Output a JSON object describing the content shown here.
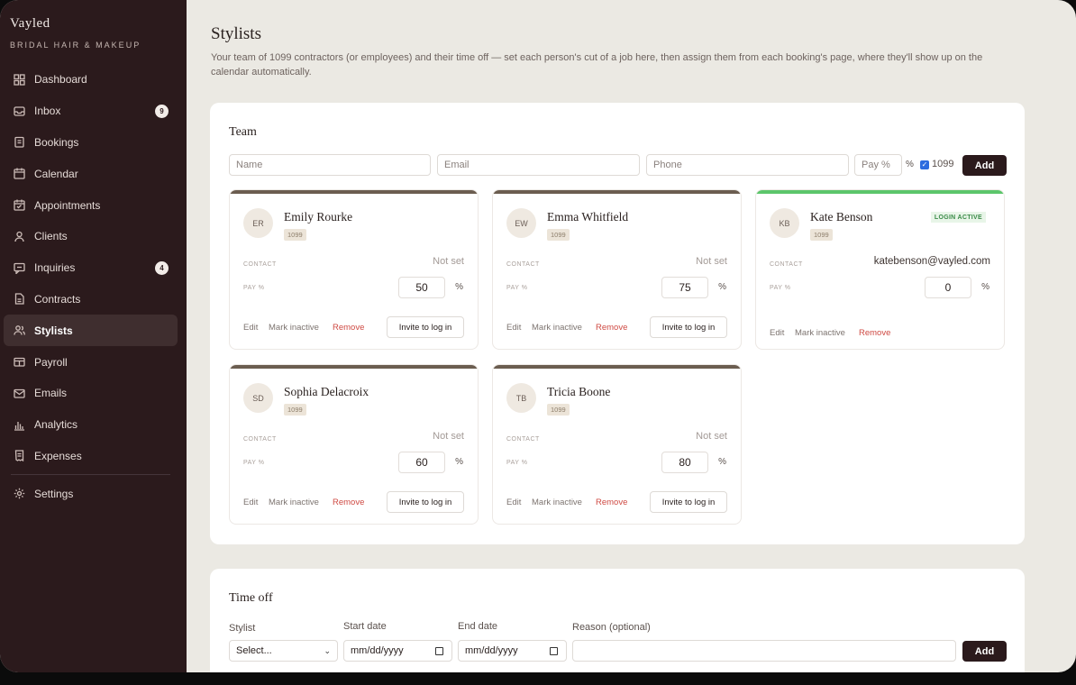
{
  "brand": {
    "name": "Vayled",
    "subtitle": "BRIDAL HAIR & MAKEUP"
  },
  "sidebar": {
    "items": [
      {
        "label": "Dashboard",
        "icon": "grid-icon"
      },
      {
        "label": "Inbox",
        "icon": "inbox-icon",
        "badge": "9"
      },
      {
        "label": "Bookings",
        "icon": "clipboard-icon"
      },
      {
        "label": "Calendar",
        "icon": "calendar-icon"
      },
      {
        "label": "Appointments",
        "icon": "calendar-check-icon"
      },
      {
        "label": "Clients",
        "icon": "user-icon"
      },
      {
        "label": "Inquiries",
        "icon": "message-icon",
        "badge": "4"
      },
      {
        "label": "Contracts",
        "icon": "document-icon"
      },
      {
        "label": "Stylists",
        "icon": "users-icon",
        "active": true
      },
      {
        "label": "Payroll",
        "icon": "wallet-icon"
      },
      {
        "label": "Emails",
        "icon": "mail-icon"
      },
      {
        "label": "Analytics",
        "icon": "bar-chart-icon"
      },
      {
        "label": "Expenses",
        "icon": "receipt-icon"
      },
      {
        "label": "Settings",
        "icon": "gear-icon"
      }
    ]
  },
  "page": {
    "title": "Stylists",
    "description": "Your team of 1099 contractors (or employees) and their time off — set each person's cut of a job here, then assign them from each booking's page, where they'll show up on the calendar automatically."
  },
  "team": {
    "title": "Team",
    "form": {
      "name_placeholder": "Name",
      "email_placeholder": "Email",
      "phone_placeholder": "Phone",
      "pay_placeholder": "Pay %",
      "pct": "%",
      "checkbox_label": "1099",
      "checkbox_checked": true,
      "add_label": "Add"
    },
    "labels": {
      "contact": "CONTACT",
      "pay": "PAY %",
      "pct": "%",
      "edit": "Edit",
      "inactive": "Mark inactive",
      "remove": "Remove",
      "invite": "Invite to log in",
      "login_active": "LOGIN ACTIVE"
    },
    "members": [
      {
        "initials": "ER",
        "name": "Emily Rourke",
        "tag": "1099",
        "contact": "Not set",
        "pay": "50"
      },
      {
        "initials": "EW",
        "name": "Emma Whitfield",
        "tag": "1099",
        "contact": "Not set",
        "pay": "75"
      },
      {
        "initials": "KB",
        "name": "Kate Benson",
        "tag": "1099",
        "contact": "katebenson@vayled.com",
        "pay": "0",
        "login_active": true
      },
      {
        "initials": "SD",
        "name": "Sophia Delacroix",
        "tag": "1099",
        "contact": "Not set",
        "pay": "60"
      },
      {
        "initials": "TB",
        "name": "Tricia Boone",
        "tag": "1099",
        "contact": "Not set",
        "pay": "80"
      }
    ]
  },
  "timeoff": {
    "title": "Time off",
    "stylist_label": "Stylist",
    "stylist_value": "Select...",
    "start_label": "Start date",
    "start_placeholder": "mm/dd/yyyy",
    "end_label": "End date",
    "end_placeholder": "mm/dd/yyyy",
    "reason_label": "Reason (optional)",
    "add_label": "Add"
  },
  "colors": {
    "sidebar_bg": "#2b1a1c",
    "accent": "#2b1a1c",
    "remove": "#cf4a43",
    "login_bar": "#5cc66b"
  }
}
